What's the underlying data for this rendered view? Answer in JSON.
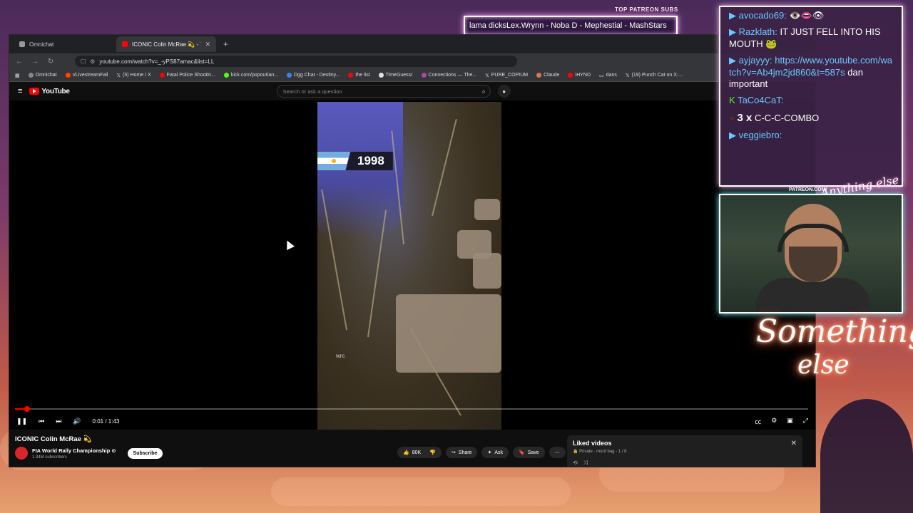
{
  "browser": {
    "tabs": [
      {
        "label": "Omnichat",
        "active": false
      },
      {
        "label": "ICONIC Colin McRae 💫 - You",
        "active": true
      }
    ],
    "url": "youtube.com/watch?v=_-yPS87amac&list=LL",
    "bookmarks": [
      "Omnichat",
      "r/LivestreamFail",
      "(5) Home / X",
      "Fatal Police Shootin...",
      "kick.com/popout/an...",
      "Dgg Chat - Destiny...",
      "the list",
      "TimeGuessr",
      "Connections — The...",
      "PURE_COPIUM",
      "Claude",
      "IHYND",
      "dans",
      "(19) Punch Cat on X:..."
    ]
  },
  "youtube": {
    "logo": "YouTube",
    "search_placeholder": "Search or ask a question",
    "video": {
      "year_label": "1998",
      "watermark": "wrc",
      "current_time": "0:01 / 1:43",
      "progress": 0.015
    },
    "title": "ICONIC Colin McRae 💫",
    "channel": {
      "name": "FIA World Rally Championship ⊙",
      "subscribers": "1.34M subscribers",
      "subscribe_label": "Subscribe"
    },
    "actions": {
      "likes": "80K",
      "share": "Share",
      "ask": "Ask",
      "save": "Save"
    },
    "playlist": {
      "title": "Liked videos",
      "meta": "🔒 Private · murd bag - 1 / 8"
    }
  },
  "overlay": {
    "patreon_label": "TOP PATREON SUBS",
    "marquee": "lama dicksLex.Wrynn  -  Noba D - Mephestial - MashStars",
    "chat": [
      {
        "user": "avocado69:",
        "text": "👁‍👄👁"
      },
      {
        "user": "Razklath:",
        "text": "IT JUST FELL INTO HIS MOUTH 🐸"
      },
      {
        "user": "ayjayyy:",
        "text": "",
        "link": "https://www.youtube.com/watch?v=Ab4jm2jd860&t=587s",
        "after": " dan important"
      },
      {
        "user": "TaCo4CaT:",
        "text": ""
      },
      {
        "combo_count": "3 x",
        "combo_text": "C-C-C-COMBO"
      },
      {
        "user": "veggiebro:",
        "text": ""
      }
    ],
    "cam_label": "PATREON.COM/",
    "brand_text": "Anything else",
    "neon_line1": "Something",
    "neon_line2": "else"
  },
  "colors": {
    "accent_red": "#ff0000",
    "chat_user": "#69c8ff",
    "neon_border": "#ffffff"
  }
}
